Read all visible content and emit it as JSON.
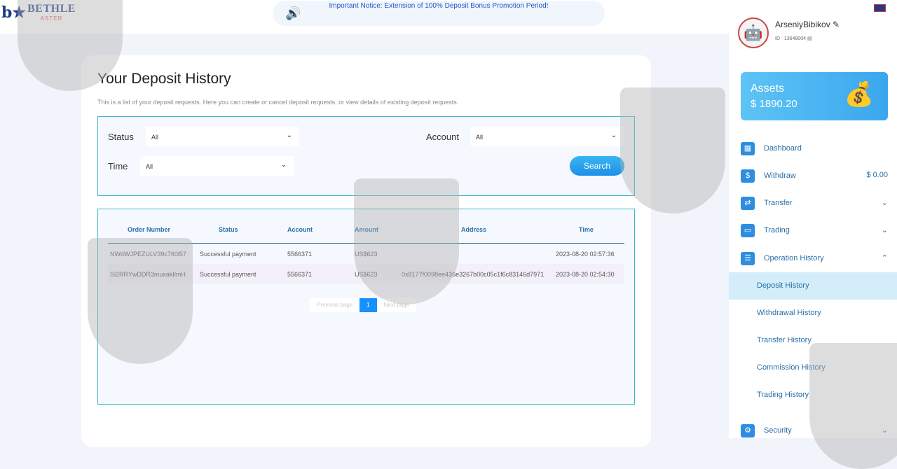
{
  "header": {
    "logo_text": "BETHLE",
    "logo_sub": "ASTER",
    "notice": "Important Notice: Extension of 100% Deposit Bonus Promotion Period!"
  },
  "page": {
    "title": "Your Deposit History",
    "description": "This is a list of your deposit requests. Here you can create or cancel deposit requests, or view details of existing deposit requests."
  },
  "filters": {
    "status_label": "Status",
    "status_value": "All",
    "account_label": "Account",
    "account_value": "All",
    "time_label": "Time",
    "time_value": "All",
    "search_label": "Search"
  },
  "table": {
    "headers": [
      "Order Number",
      "Status",
      "Account",
      "Amount",
      "Address",
      "Time"
    ],
    "rows": [
      [
        "NWdWJPEZULV39c760l57",
        "Successful payment",
        "5566371",
        "US$623",
        "",
        "2023-08-20 02:57:36"
      ],
      [
        "Si2RRYwDDR3muxakIlmH",
        "Successful payment",
        "5566371",
        "US$623",
        "0x8177f0098ee436e3267b00c05c1f6c83146d7971",
        "2023-08-20 02:54:30"
      ]
    ]
  },
  "pagination": {
    "prev": "Previous page",
    "current": "1",
    "next": "Next page"
  },
  "user": {
    "name": "ArseniyBibikov",
    "id_label": "ID",
    "id": "13648004"
  },
  "assets": {
    "label": "Assets",
    "value": "$ 1890.20"
  },
  "nav": {
    "dashboard": "Dashboard",
    "withdraw": "Withdraw",
    "withdraw_amount": "$ 0.00",
    "transfer": "Transfer",
    "trading": "Trading",
    "operation_history": "Operation History",
    "security": "Security",
    "sub": [
      "Deposit History",
      "Withdrawal History",
      "Transfer History",
      "Commission History",
      "Trading History"
    ]
  }
}
